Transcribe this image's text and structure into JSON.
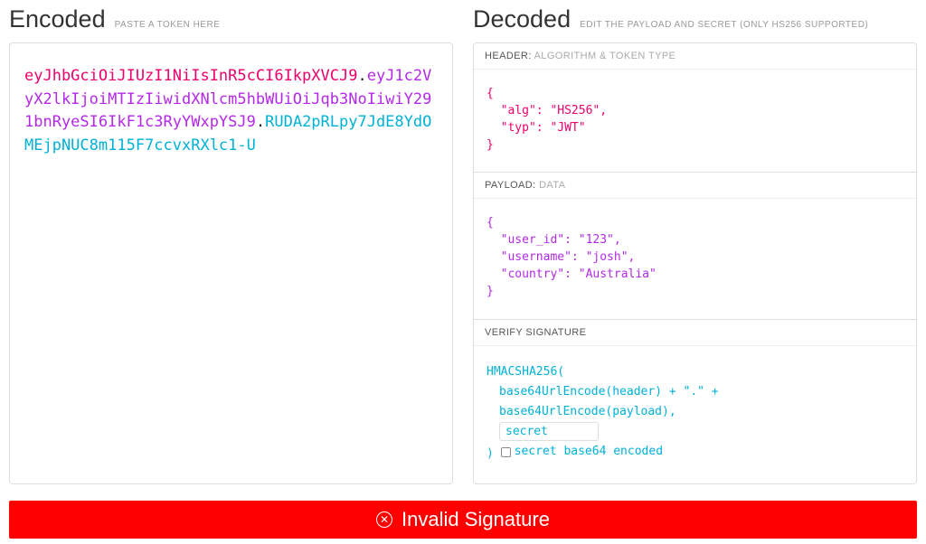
{
  "encoded": {
    "title": "Encoded",
    "subtitle": "PASTE A TOKEN HERE",
    "token_header": "eyJhbGciOiJIUzI1NiIsInR5cCI6IkpXVCJ9",
    "token_payload": "eyJ1c2VyX2lkIjoiMTIzIiwidXNlcm5hbWUiOiJqb3NoIiwiY291bnRyeSI6IkF1c3RyYWxpYSJ9",
    "token_sig": "RUDA2pRLpy7JdE8YdOMEjpNUC8m115F7ccvxRXlc1-U"
  },
  "decoded": {
    "title": "Decoded",
    "subtitle": "EDIT THE PAYLOAD AND SECRET (ONLY HS256 SUPPORTED)",
    "header_section": {
      "label": "HEADER:",
      "sublabel": "ALGORITHM & TOKEN TYPE",
      "json": "{\n  \"alg\": \"HS256\",\n  \"typ\": \"JWT\"\n}"
    },
    "payload_section": {
      "label": "PAYLOAD:",
      "sublabel": "DATA",
      "json": "{\n  \"user_id\": \"123\",\n  \"username\": \"josh\",\n  \"country\": \"Australia\"\n}"
    },
    "signature_section": {
      "label": "VERIFY SIGNATURE",
      "line1": "HMACSHA256(",
      "line2": "  base64UrlEncode(header) + \".\" +",
      "line3": "  base64UrlEncode(payload),",
      "secret_value": "secret",
      "closing": ")",
      "checkbox_label": "secret base64 encoded"
    }
  },
  "status": {
    "text": "Invalid Signature"
  }
}
